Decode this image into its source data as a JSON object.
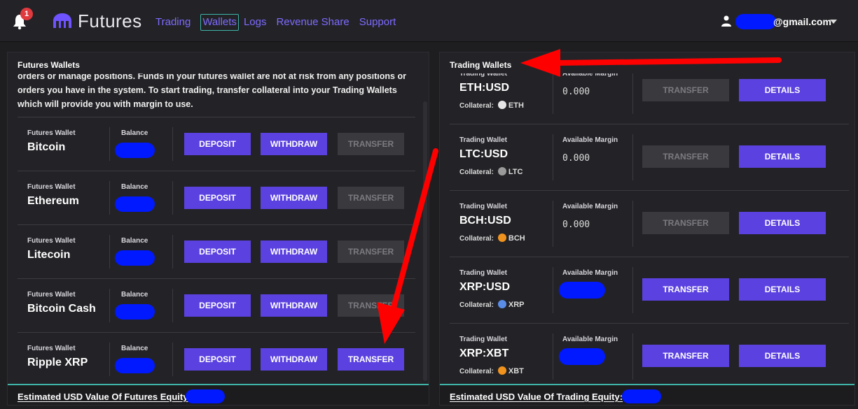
{
  "topbar": {
    "badge_count": "1",
    "brand": "Futures",
    "nav": [
      "Trading",
      "Wallets",
      "Logs",
      "Revenue Share",
      "Support"
    ],
    "active_nav": "Wallets",
    "email_suffix": "@gmail.com"
  },
  "left_panel": {
    "title": "Futures Wallets",
    "description": "orders or manage positions. Funds in your futures wallet are not at risk from any positions or orders you have in the system. To start trading, transfer collateral into your Trading Wallets which will provide you with margin to use.",
    "wallet_label": "Futures Wallet",
    "balance_label": "Balance",
    "deposit_label": "DEPOSIT",
    "withdraw_label": "WITHDRAW",
    "transfer_label": "TRANSFER",
    "wallets": [
      {
        "name": "Bitcoin",
        "transfer_enabled": false
      },
      {
        "name": "Ethereum",
        "transfer_enabled": false
      },
      {
        "name": "Litecoin",
        "transfer_enabled": false
      },
      {
        "name": "Bitcoin Cash",
        "transfer_enabled": false
      },
      {
        "name": "Ripple XRP",
        "transfer_enabled": true
      }
    ],
    "footer": "Estimated USD Value Of Futures Equity:"
  },
  "right_panel": {
    "title": "Trading Wallets",
    "wallet_label": "Trading Wallet",
    "margin_label": "Available Margin",
    "collateral_label": "Collateral:",
    "transfer_label": "TRANSFER",
    "details_label": "DETAILS",
    "wallets": [
      {
        "pair": "ETH:USD",
        "coin": "ETH",
        "margin": "0.000",
        "transfer_enabled": false,
        "coin_color": "#e6e6e6"
      },
      {
        "pair": "LTC:USD",
        "coin": "LTC",
        "margin": "0.000",
        "transfer_enabled": false,
        "coin_color": "#9a9a9a"
      },
      {
        "pair": "BCH:USD",
        "coin": "BCH",
        "margin": "0.000",
        "transfer_enabled": false,
        "coin_color": "#f0931e"
      },
      {
        "pair": "XRP:USD",
        "coin": "XRP",
        "margin": "",
        "transfer_enabled": true,
        "coin_color": "#5a8de8"
      },
      {
        "pair": "XRP:XBT",
        "coin": "XBT",
        "margin": "",
        "transfer_enabled": true,
        "coin_color": "#f0931e"
      }
    ],
    "footer": "Estimated USD Value Of Trading Equity:"
  },
  "colors": {
    "accent": "#5b41e0",
    "teal": "#3fb3a8",
    "redact": "#0019ff",
    "arrow": "#ff0000"
  }
}
